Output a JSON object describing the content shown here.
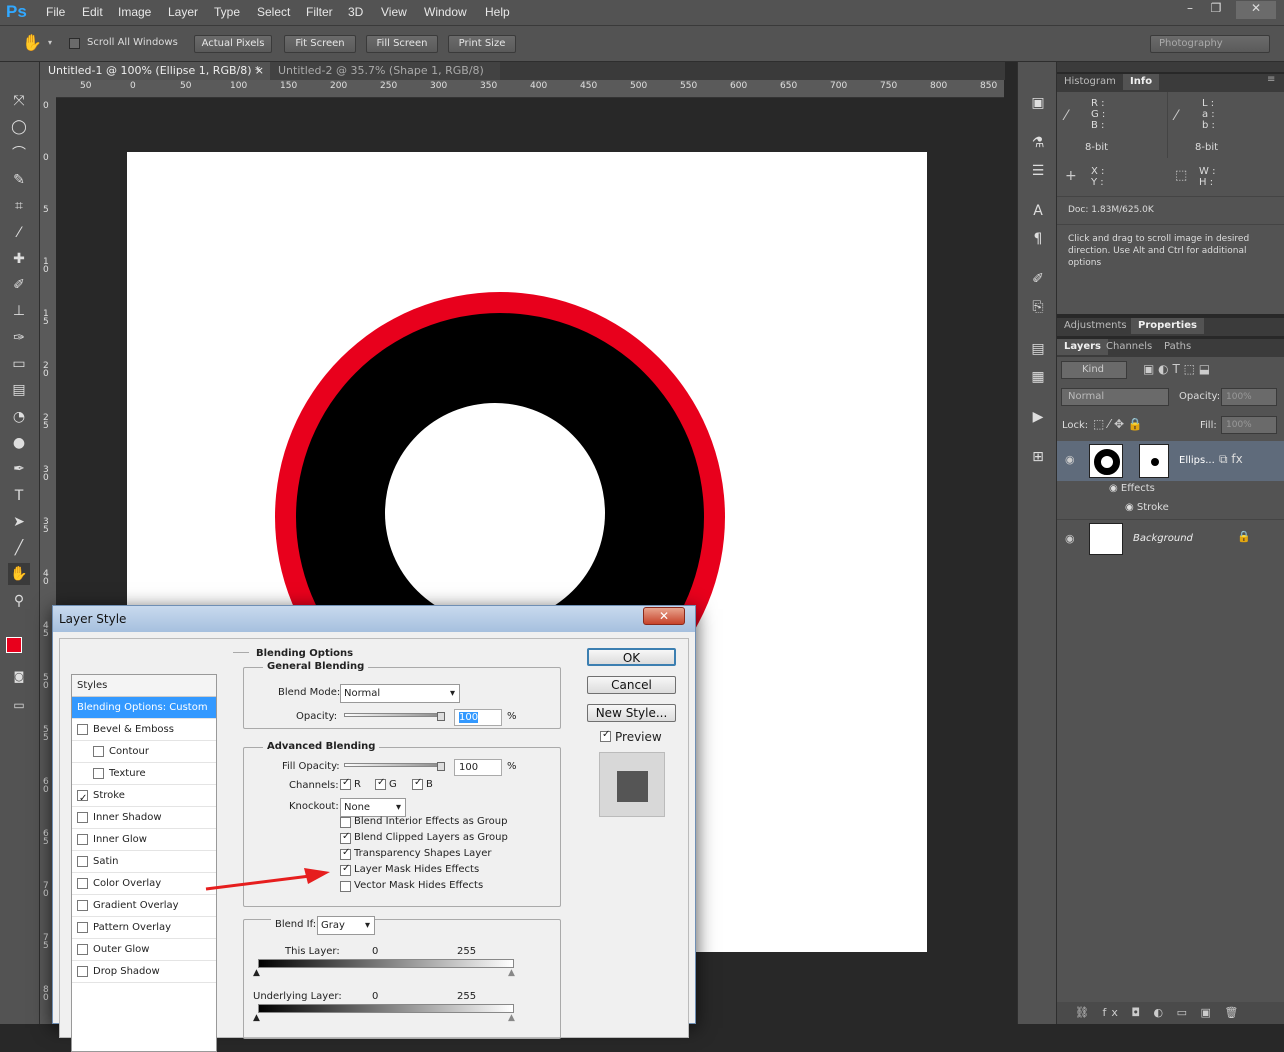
{
  "app": {
    "logo": "Ps"
  },
  "menu": [
    "File",
    "Edit",
    "Image",
    "Layer",
    "Type",
    "Select",
    "Filter",
    "3D",
    "View",
    "Window",
    "Help"
  ],
  "window_controls": [
    "–",
    "❐",
    "✕"
  ],
  "options": {
    "scroll_all": "Scroll All Windows",
    "actual_pixels": "Actual Pixels",
    "fit_screen": "Fit Screen",
    "fill_screen": "Fill Screen",
    "print_size": "Print Size",
    "workspace": "Photography"
  },
  "tabs": [
    {
      "label": "Untitled-1 @ 100% (Ellipse 1, RGB/8) *",
      "close": "×"
    },
    {
      "label": "Untitled-2 @ 35.7% (Shape 1, RGB/8) *",
      "close": "×"
    }
  ],
  "ruler_h": [
    "50",
    "0",
    "50",
    "100",
    "150",
    "200",
    "250",
    "300",
    "350",
    "400",
    "450",
    "500",
    "550",
    "600",
    "650",
    "700",
    "750",
    "800",
    "850"
  ],
  "ruler_v": [
    "0",
    "0",
    "5",
    "1 0",
    "1 5",
    "2 0",
    "2 5",
    "3 0",
    "3 5",
    "4 0",
    "4 5",
    "5 0",
    "5 5",
    "6 0",
    "6 5",
    "7 0",
    "7 5",
    "8 0"
  ],
  "info_panel": {
    "tabs": [
      "Histogram",
      "Info"
    ],
    "rgb": [
      "R :",
      "G :",
      "B :"
    ],
    "lab": [
      "L :",
      "a :",
      "b :"
    ],
    "bit1": "8-bit",
    "bit2": "8-bit",
    "xy": [
      "X :",
      "Y :"
    ],
    "wh": [
      "W :",
      "H :"
    ],
    "doc": "Doc: 1.83M/625.0K",
    "hint": "Click and drag to scroll image in desired direction.  Use Alt and Ctrl for additional options"
  },
  "adj_tabs": [
    "Adjustments",
    "Properties"
  ],
  "layers_panel": {
    "tabs": [
      "Layers",
      "Channels",
      "Paths"
    ],
    "kind": "Kind",
    "blend": "Normal",
    "opacity_label": "Opacity:",
    "opacity": "100%",
    "lock_label": "Lock:",
    "fill_label": "Fill:",
    "fill": "100%",
    "layer1": "Ellips...",
    "effects": "Effects",
    "stroke": "Stroke",
    "background": "Background"
  },
  "dialog": {
    "title": "Layer Style",
    "close": "✕",
    "styles_header": "Styles",
    "styles": [
      {
        "label": "Blending Options: Custom",
        "checkbox": false,
        "checked": false,
        "selected": true
      },
      {
        "label": "Bevel & Emboss",
        "checkbox": true,
        "checked": false
      },
      {
        "label": "Contour",
        "checkbox": true,
        "checked": false,
        "indent": true
      },
      {
        "label": "Texture",
        "checkbox": true,
        "checked": false,
        "indent": true
      },
      {
        "label": "Stroke",
        "checkbox": true,
        "checked": true
      },
      {
        "label": "Inner Shadow",
        "checkbox": true,
        "checked": false
      },
      {
        "label": "Inner Glow",
        "checkbox": true,
        "checked": false
      },
      {
        "label": "Satin",
        "checkbox": true,
        "checked": false
      },
      {
        "label": "Color Overlay",
        "checkbox": true,
        "checked": false
      },
      {
        "label": "Gradient Overlay",
        "checkbox": true,
        "checked": false
      },
      {
        "label": "Pattern Overlay",
        "checkbox": true,
        "checked": false
      },
      {
        "label": "Outer Glow",
        "checkbox": true,
        "checked": false
      },
      {
        "label": "Drop Shadow",
        "checkbox": true,
        "checked": false
      }
    ],
    "blending_options": "Blending Options",
    "general_blending": "General Blending",
    "blend_mode_label": "Blend Mode:",
    "blend_mode": "Normal",
    "opacity_label": "Opacity:",
    "opacity": "100",
    "pct": "%",
    "advanced_blending": "Advanced Blending",
    "fill_opacity_label": "Fill Opacity:",
    "fill_opacity": "100",
    "channels_label": "Channels:",
    "channels": [
      "R",
      "G",
      "B"
    ],
    "knockout_label": "Knockout:",
    "knockout": "None",
    "adv_checks": [
      {
        "label": "Blend Interior Effects as Group",
        "checked": false
      },
      {
        "label": "Blend Clipped Layers as Group",
        "checked": true
      },
      {
        "label": "Transparency Shapes Layer",
        "checked": true
      },
      {
        "label": "Layer Mask Hides Effects",
        "checked": true
      },
      {
        "label": "Vector Mask Hides Effects",
        "checked": false
      }
    ],
    "blend_if_label": "Blend If:",
    "blend_if": "Gray",
    "this_layer": "This Layer:",
    "underlying": "Underlying Layer:",
    "zero": "0",
    "max": "255",
    "ok": "OK",
    "cancel": "Cancel",
    "new_style": "New Style...",
    "preview": "Preview"
  },
  "colors": {
    "accent_red": "#e8001c",
    "selection_blue": "#3399ff",
    "arrow_red": "#e61e1e"
  }
}
